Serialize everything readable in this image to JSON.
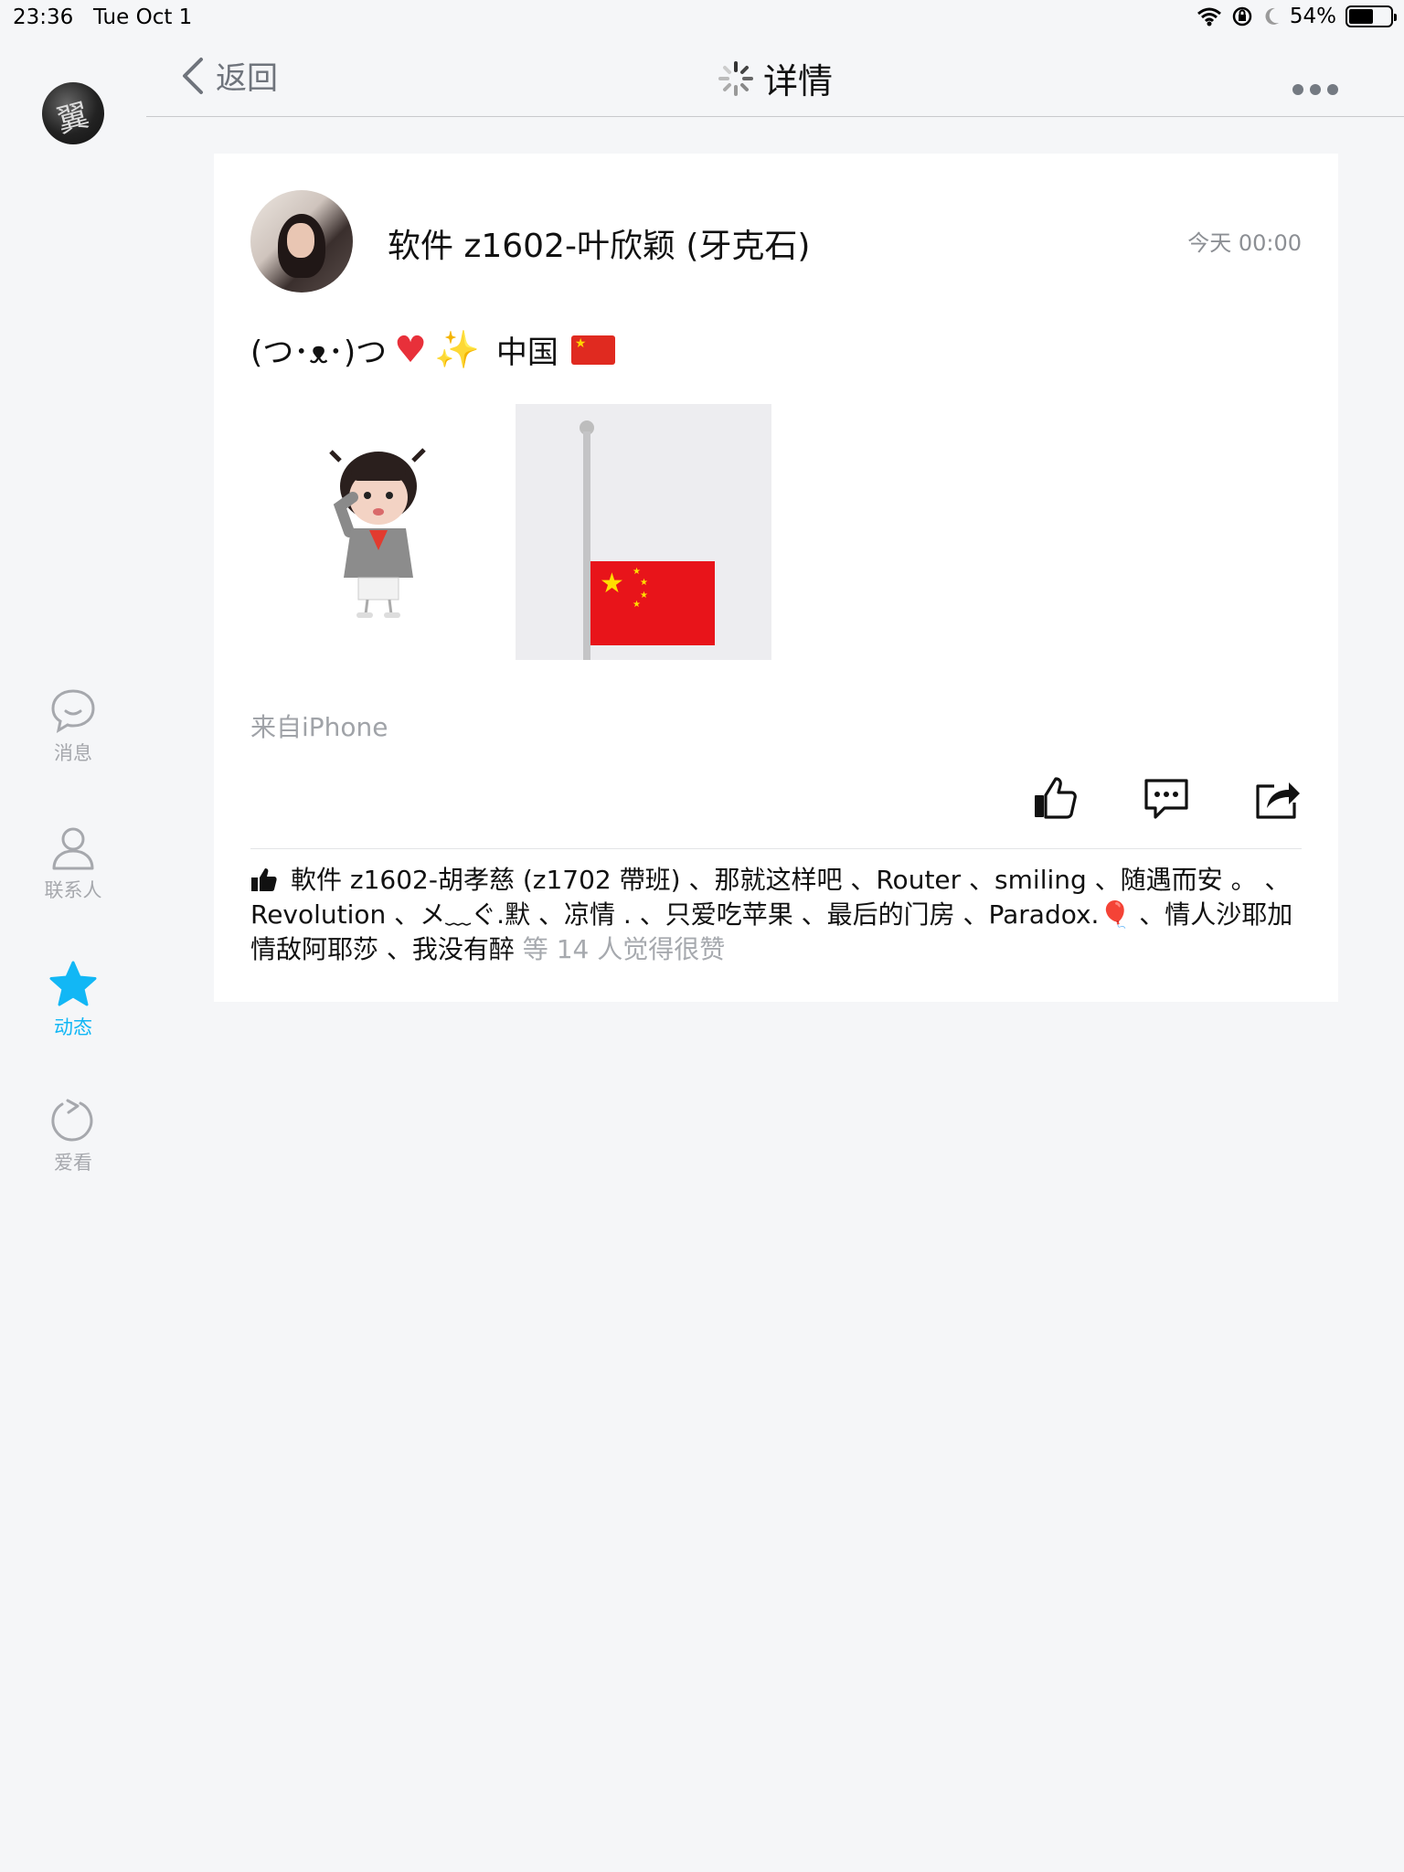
{
  "status_bar": {
    "time": "23:36",
    "date": "Tue Oct 1",
    "battery_text": "54%",
    "battery_level": 0.54
  },
  "header": {
    "back_label": "返回",
    "title": "详情"
  },
  "sidebar": {
    "items": [
      {
        "label": "消息",
        "icon": "chat-bubble-icon"
      },
      {
        "label": "联系人",
        "icon": "person-icon"
      },
      {
        "label": "动态",
        "icon": "star-icon",
        "active": true
      },
      {
        "label": "爱看",
        "icon": "refresh-circle-icon"
      }
    ]
  },
  "post": {
    "author": "软件 z1602-叶欣颖 (牙克石)",
    "timestamp": "今天 00:00",
    "text_prefix": "(つ･ᴥ･)つ",
    "text_location": "中国",
    "source": "来自iPhone",
    "likers_text": "軟件 z1602-胡孝慈 (z1702 帶班) 、那就这样吧 、Router 、smiling 、随遇而安 。 、 Revolution 、メ﹏ぐ.默 、凉情 . 、只爱吃苹果 、最后的门房 、Paradox.",
    "likers_text_tail": " 、情人沙耶加情敌阿耶莎 、我没有醉",
    "like_count_text": " 等 14 人觉得很赞"
  },
  "colors": {
    "accent": "#12b7f5",
    "gray_text": "#a6a8ad",
    "flag_red": "#e02a20",
    "flag_yellow": "#ffd400"
  }
}
